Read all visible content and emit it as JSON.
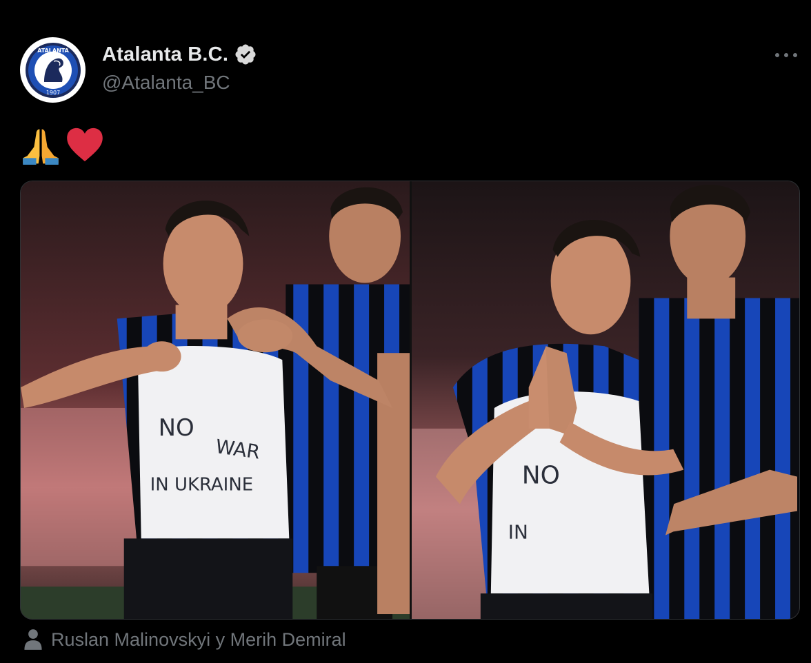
{
  "author": {
    "display_name": "Atalanta B.C.",
    "handle": "@Atalanta_BC",
    "verified": true,
    "avatar_logo": "atalanta-crest",
    "avatar_text_top": "ATALANTA",
    "avatar_text_bottom": "1907"
  },
  "tweet": {
    "emojis": [
      "folded-hands",
      "red-heart"
    ],
    "shirt_text_line1": "NO",
    "shirt_text_line2": "WAR",
    "shirt_text_line3": "IN UKRAINE",
    "shirt_text_right_line1": "NO",
    "shirt_text_right_line2": "IN"
  },
  "media": {
    "count": 2,
    "photo_kind": "football-players-photo"
  },
  "tagged_people": "Ruslan Malinovskyi y Merih Demiral",
  "colors": {
    "background": "#000000",
    "primary_text": "#e7e9ea",
    "secondary_text": "#71767b",
    "jersey_blue": "#1a4fc9",
    "jersey_black": "#0b0c10",
    "heart_red": "#dd2e44"
  }
}
